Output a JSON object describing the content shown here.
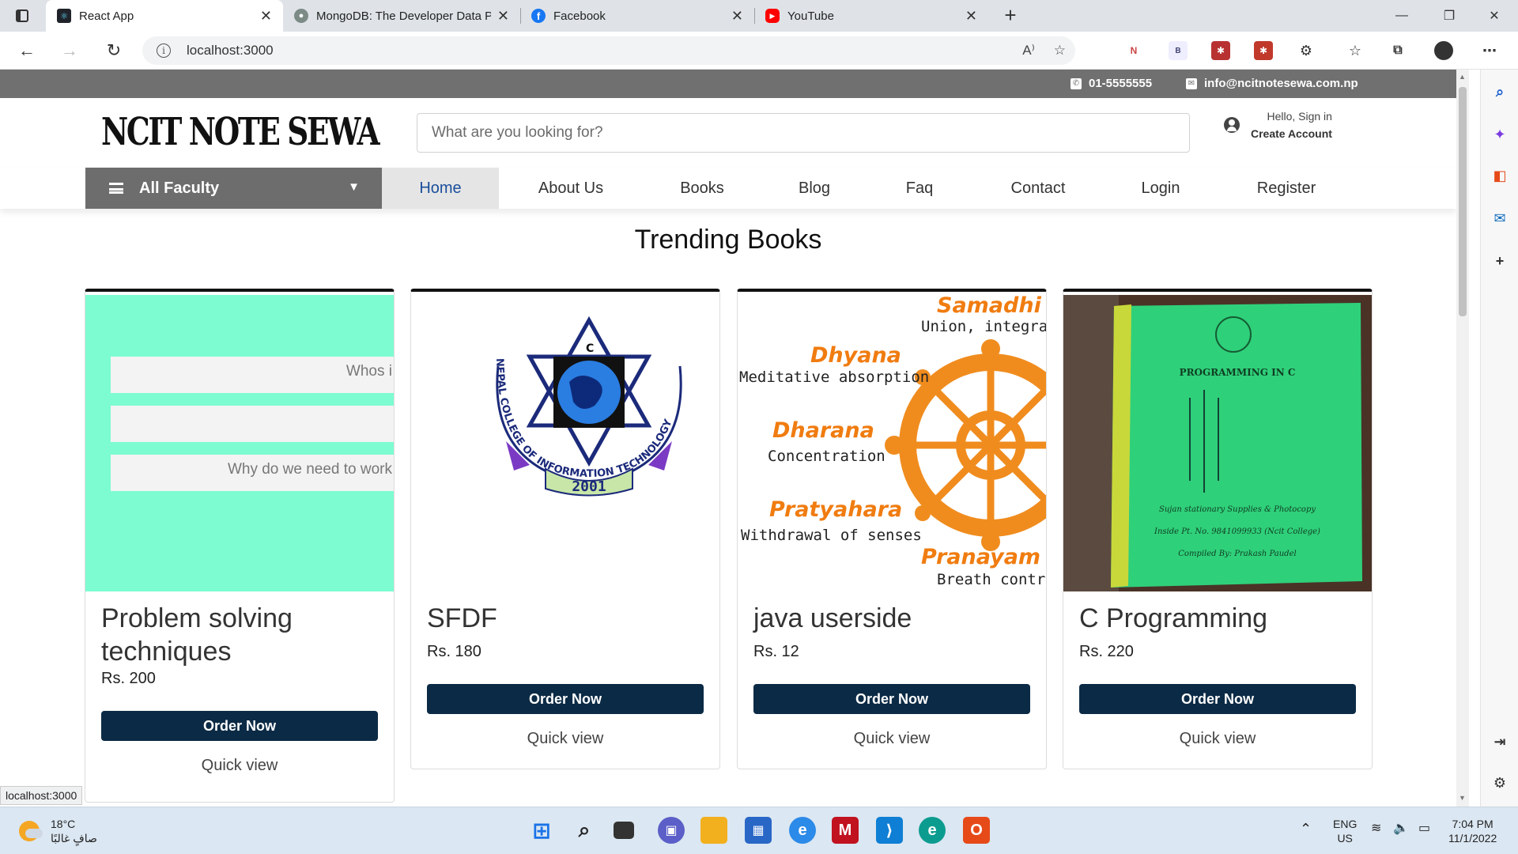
{
  "browser": {
    "tabs": [
      {
        "title": "React App",
        "favicon_color": "#20232a",
        "active": true
      },
      {
        "title": "MongoDB: The Developer Data P",
        "favicon_color": "#7d8b86",
        "active": false
      },
      {
        "title": "Facebook",
        "favicon_color": "#1877f2",
        "active": false
      },
      {
        "title": "YouTube",
        "favicon_color": "#ff0000",
        "active": false
      }
    ],
    "url": "localhost:3000",
    "status_url": "localhost:3000"
  },
  "site": {
    "phone": "01-5555555",
    "email": "info@ncitnotesewa.com.np",
    "logo_text": "NCIT NOTE SEWA",
    "search_placeholder": "What are you looking for?",
    "greeting": "Hello, Sign in",
    "account": "Create Account",
    "faculty_label": "All Faculty",
    "nav": [
      {
        "label": "Home",
        "active": true
      },
      {
        "label": "About Us"
      },
      {
        "label": "Books"
      },
      {
        "label": "Blog"
      },
      {
        "label": "Faq"
      },
      {
        "label": "Contact"
      },
      {
        "label": "Login"
      },
      {
        "label": "Register"
      }
    ],
    "section_title": "Trending Books",
    "order_label": "Order Now",
    "quickview_label": "Quick view",
    "books": [
      {
        "title": "Problem solving techniques",
        "price": "Rs. 200",
        "image_texts": [
          "Whos i",
          "",
          "Why do we need to work"
        ]
      },
      {
        "title": "SFDF",
        "price": "Rs. 180",
        "image_texts": [
          "C",
          "NEPAL COLLEGE OF INFORMATION TECHNOLOGY",
          "2001"
        ]
      },
      {
        "title": "java userside",
        "price": "Rs. 12",
        "image_texts": [
          "Samadhi",
          "Union, integrati",
          "Dhyana",
          "Meditative absorption",
          "Dharana",
          "Concentration",
          "Pratyahara",
          "Withdrawal of senses",
          "Pranayam",
          "Breath contro"
        ]
      },
      {
        "title": "C Programming",
        "price": "Rs. 220",
        "image_texts": [
          "PROGRAMMING IN C",
          "Sujan stationary Supplies & Photocopy",
          "Inside Pt. No. 9841099933 (Ncit College)",
          "Compiled By: Prakash Paudel"
        ]
      }
    ]
  },
  "taskbar": {
    "temperature": "18°C",
    "weather_text": "صافٍ غالبًا",
    "lang": "ENG",
    "region": "US",
    "time": "7:04 PM",
    "date": "11/1/2022"
  },
  "colors": {
    "brand_navy": "#0b2a45",
    "strip_gray": "#707070",
    "faculty_gray": "#6d6d6d",
    "mint": "#7dfcd1",
    "nav_active_text": "#1a4f9c"
  }
}
